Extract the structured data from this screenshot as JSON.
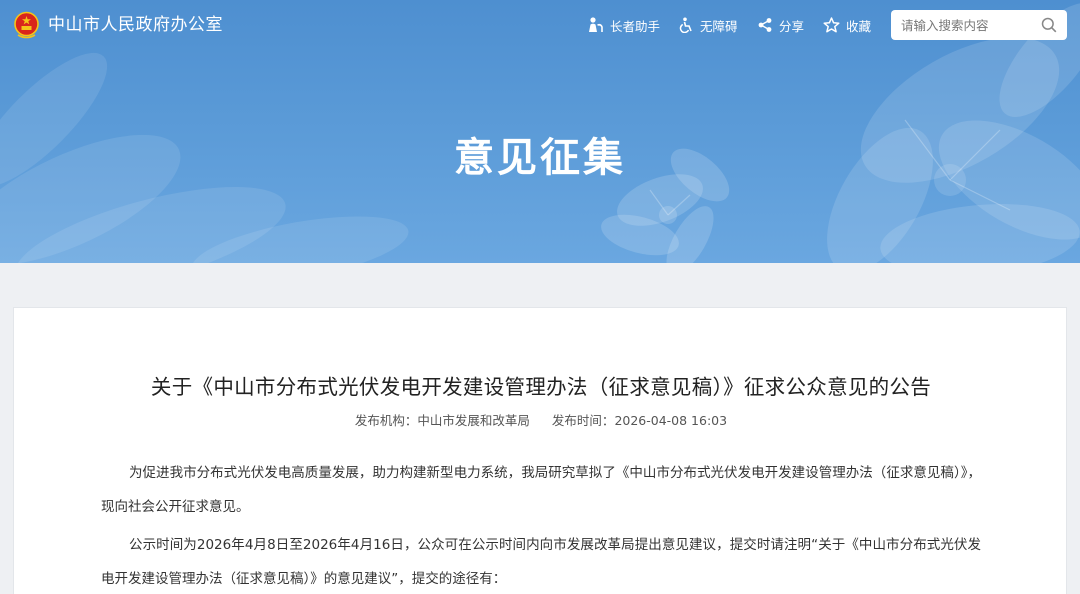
{
  "header": {
    "site_title": "中山市人民政府办公室",
    "tools": [
      {
        "label": "长者助手",
        "icon": "elder-icon"
      },
      {
        "label": "无障碍",
        "icon": "accessibility-icon"
      },
      {
        "label": "分享",
        "icon": "share-icon"
      },
      {
        "label": "收藏",
        "icon": "star-icon"
      }
    ],
    "search": {
      "placeholder": "请输入搜索内容",
      "value": ""
    }
  },
  "banner": {
    "title": "意见征集"
  },
  "article": {
    "title": "关于《中山市分布式光伏发电开发建设管理办法（征求意见稿）》征求公众意见的公告",
    "publisher_label": "发布机构：",
    "publisher": "中山市发展和改革局",
    "time_label": "发布时间：",
    "time": "2026-04-08 16:03",
    "paragraphs": [
      "为促进我市分布式光伏发电高质量发展，助力构建新型电力系统，我局研究草拟了《中山市分布式光伏发电开发建设管理办法（征求意见稿）》，现向社会公开征求意见。",
      "公示时间为2026年4月8日至2026年4月16日，公众可在公示时间内向市发展改革局提出意见建议，提交时请注明“关于《中山市分布式光伏发电开发建设管理办法（征求意见稿）》的意见建议”，提交的途径有："
    ]
  },
  "colors": {
    "banner_blue": "#5a9ad7",
    "card_bg": "#ffffff",
    "page_bg": "#eef0f3",
    "title_text": "#222222"
  }
}
